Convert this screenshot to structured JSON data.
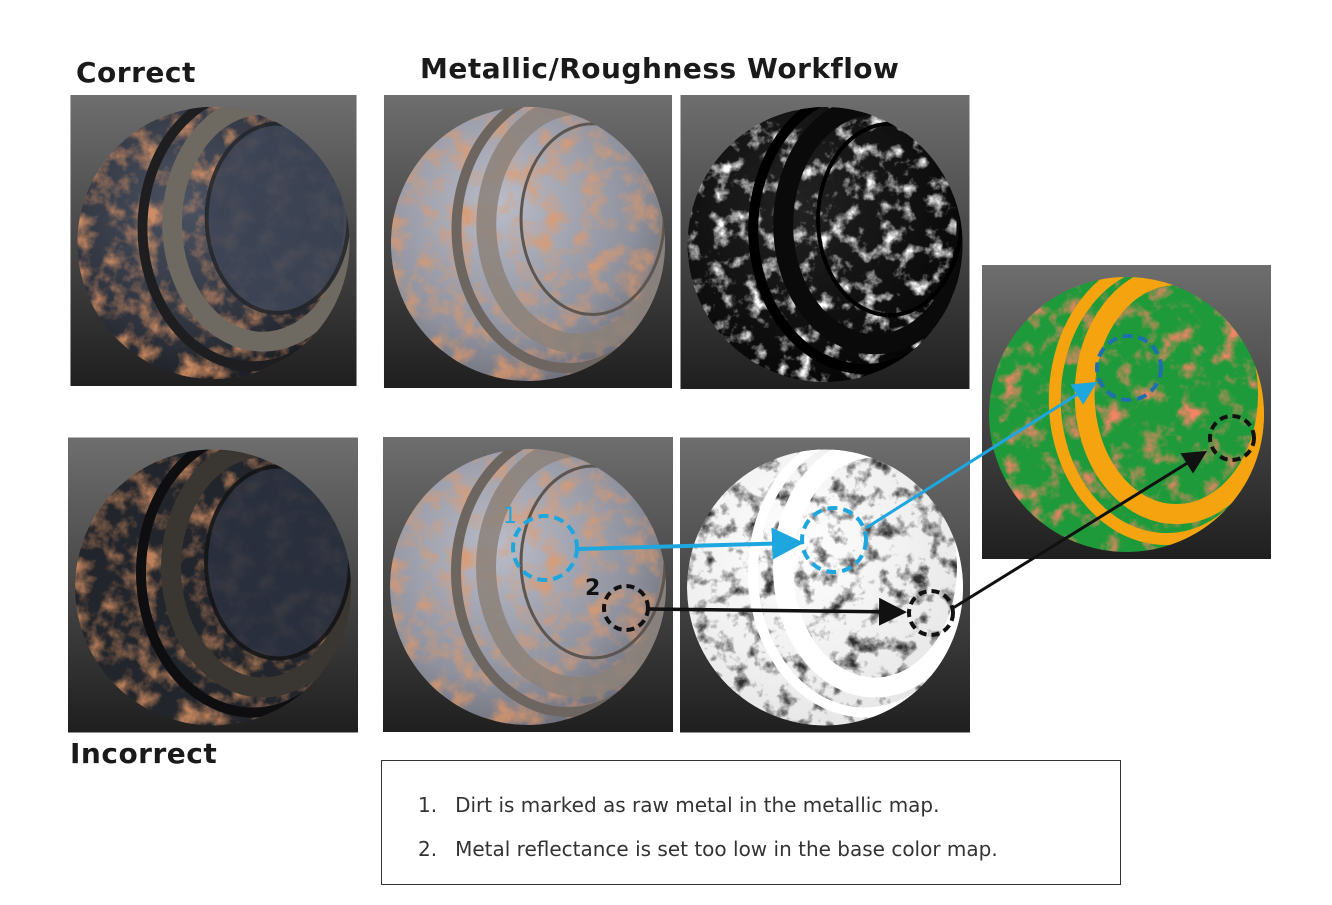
{
  "labels": {
    "correct": "Correct",
    "workflow": "Metallic/Roughness Workflow",
    "incorrect": "Incorrect"
  },
  "callouts": {
    "first": "1",
    "second": "2"
  },
  "notes": [
    {
      "num": "1.",
      "text": "Dirt is marked as raw metal in the metallic map."
    },
    {
      "num": "2.",
      "text": "Metal reflectance is set too low in the base color map."
    }
  ],
  "colors": {
    "rust": "#b8502a",
    "metal_dark": "#3b4250",
    "metal_light": "#9ea4b4",
    "callout_blue": "#1ea6df",
    "callout_black": "#111111",
    "validation_green": "#1f9a3a",
    "validation_orange": "#f5a40f",
    "validation_red": "#e33a22"
  }
}
